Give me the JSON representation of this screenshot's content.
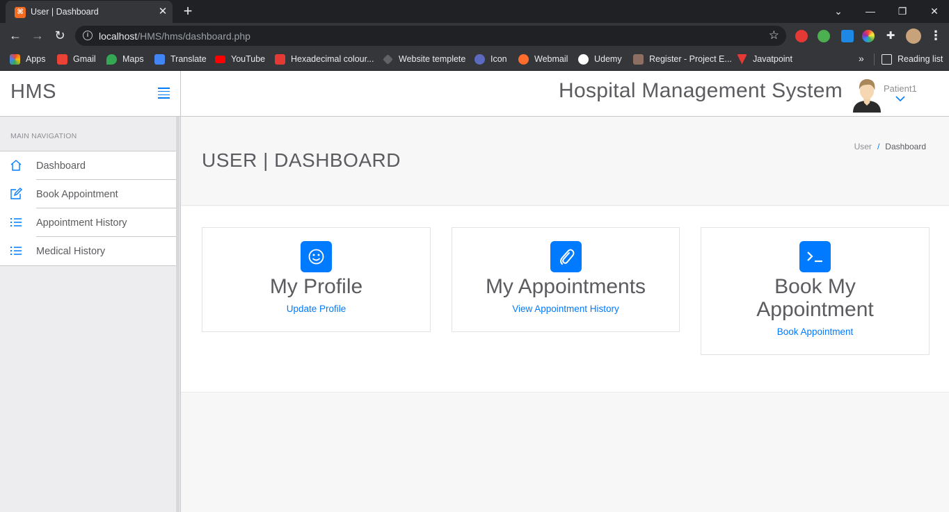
{
  "browser": {
    "tab_title": "User | Dashboard",
    "url_host": "localhost",
    "url_path": "/HMS/hms/dashboard.php",
    "bookmarks": [
      {
        "label": "Apps",
        "color": "#ea4335"
      },
      {
        "label": "Gmail",
        "color": "#ea4335"
      },
      {
        "label": "Maps",
        "color": "#34a853"
      },
      {
        "label": "Translate",
        "color": "#4285f4"
      },
      {
        "label": "YouTube",
        "color": "#ff0000"
      },
      {
        "label": "Hexadecimal colour...",
        "color": "#e53935"
      },
      {
        "label": "Website templete",
        "color": "#5f6368"
      },
      {
        "label": "Icon",
        "color": "#5c6bc0"
      },
      {
        "label": "Webmail",
        "color": "#ff6c2c"
      },
      {
        "label": "Udemy",
        "color": "#ffffff"
      },
      {
        "label": "Register - Project E...",
        "color": "#8d6e63"
      },
      {
        "label": "Javatpoint",
        "color": "#e53935"
      }
    ],
    "bookmarks_more": "»",
    "reading_list": "Reading list"
  },
  "app": {
    "brand": "HMS",
    "system_title": "Hospital Management System",
    "username": "Patient1",
    "accent_color": "#007aff"
  },
  "sidebar": {
    "heading": "MAIN NAVIGATION",
    "items": [
      {
        "label": "Dashboard",
        "icon": "home-icon"
      },
      {
        "label": "Book Appointment",
        "icon": "edit-icon"
      },
      {
        "label": "Appointment History",
        "icon": "list-icon"
      },
      {
        "label": "Medical History",
        "icon": "list-icon"
      }
    ]
  },
  "page": {
    "title": "USER | DASHBOARD",
    "breadcrumb": [
      "User",
      "Dashboard"
    ]
  },
  "cards": [
    {
      "title": "My Profile",
      "link": "Update Profile",
      "icon": "smile-icon"
    },
    {
      "title": "My Appointments",
      "link": "View Appointment History",
      "icon": "paperclip-icon"
    },
    {
      "title": "Book My Appointment",
      "link": "Book Appointment",
      "icon": "terminal-icon"
    }
  ]
}
